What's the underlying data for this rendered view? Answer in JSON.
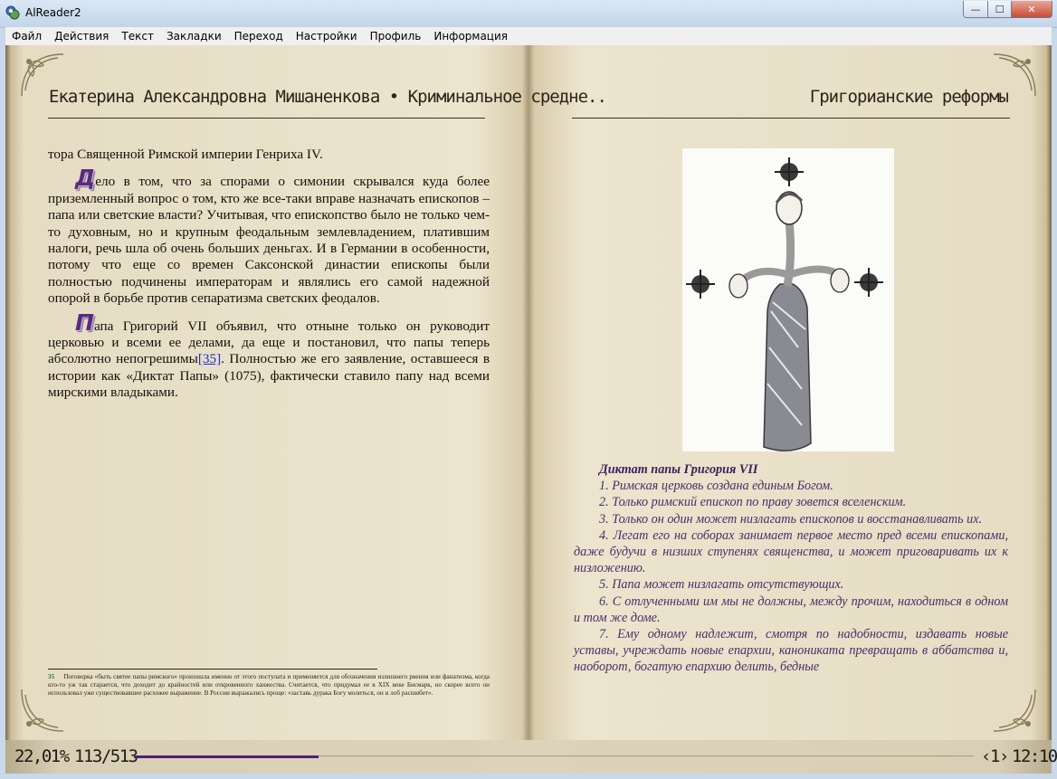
{
  "window": {
    "title": "AlReader2",
    "controls": {
      "minimize": "—",
      "maximize": "☐",
      "close": "✕"
    }
  },
  "menu": [
    "Файл",
    "Действия",
    "Текст",
    "Закладки",
    "Переход",
    "Настройки",
    "Профиль",
    "Информация"
  ],
  "left_page": {
    "header": "Екатерина Александровна Мишаненкова • Криминальное средне..",
    "first_line": "тора Священной Римской империи Генриха IV.",
    "para1_cap": "Д",
    "para1": "ело в том, что за спорами о симонии скрывался куда более приземленный вопрос о том, кто же все-таки вправе назначать епископов – папа или светские власти? Учитывая, что епископство было не только чем-то духовным, но и крупным феодальным землевладением, платившим налоги, речь шла об очень больших деньгах. И в Германии в особенности, потому что еще со времен Саксонской династии епископы были полностью подчинены императорам и являлись его самой надежной опорой в борьбе против сепаратизма светских феодалов.",
    "para2_cap": "П",
    "para2_before": "апа Григорий VII объявил, что отныне только он руководит церковью и всеми ее делами, да еще и постановил, что папы теперь абсолютно непогрешимы",
    "para2_link": "[35]",
    "para2_after": ". Полностью же его заявление, оставшееся в истории как «Диктат Папы» (1075), фактически ставило папу над всеми мирскими владыками.",
    "footnote_num": "35",
    "footnote": "Поговорка «быть святее папы римского» произошла именно от этого постулата и применяется для обозначения излишнего рвения или фанатизма, когда кто-то уж так старается, что доходит до крайностей или откровенного ханжества. Считается, что придумал ее в XIX веке Бисмарк, но скорее всего он использовал уже существовавшее расхожее выражение. В России выражались проще: «заставь дурака Богу молиться, он и лоб расшибет»."
  },
  "right_page": {
    "header": "Григорианские реформы",
    "excerpt_title": "Диктат папы Григория VII",
    "excerpt": [
      "1. Римская церковь создана единым Богом.",
      "2. Только римский епископ по праву зовется вселенским.",
      "3. Только он один может низлагать епископов и восстанавливать их.",
      "4. Легат его на соборах занимает первое место пред всеми епископами, даже будучи в низших ступенях священства, и может приговаривать их к низложению.",
      "5. Папа может низлагать отсутствующих.",
      "6. С отлученными им мы не должны, между прочим, находиться в одном и том же доме.",
      "7. Ему одному надлежит, смотря по надобности, издавать новые уставы, учреждать новые епархии, канониката превращать в аббатства и, наоборот, богатую епархию делить, бедные"
    ]
  },
  "status": {
    "percent": "22,01%",
    "pages": "113/513",
    "progress": 0.2201,
    "page_nav": "‹1›",
    "clock": "12:10"
  },
  "colors": {
    "accent": "#4e2070",
    "dropcap": "#5b2a80",
    "excerpt": "#4a2d67",
    "link": "#1e2ad8"
  }
}
